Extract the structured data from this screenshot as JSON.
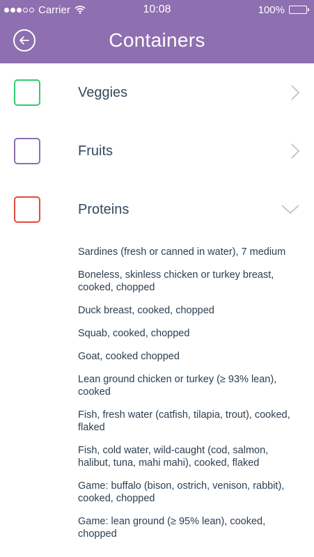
{
  "status_bar": {
    "carrier": "Carrier",
    "time": "10:08",
    "battery": "100%"
  },
  "header": {
    "title": "Containers"
  },
  "categories": [
    {
      "label": "Veggies",
      "color": "#2ecc71",
      "state": "collapsed"
    },
    {
      "label": "Fruits",
      "color": "#8e6fb0",
      "state": "collapsed"
    },
    {
      "label": "Proteins",
      "color": "#e24a3b",
      "state": "expanded"
    }
  ],
  "protein_items": [
    "Sardines (fresh or canned in water), 7 medium",
    "Boneless, skinless chicken or turkey breast, cooked, chopped",
    "Duck breast, cooked, chopped",
    "Squab, cooked, chopped",
    "Goat, cooked chopped",
    "Lean ground chicken or turkey (≥ 93% lean), cooked",
    "Fish, fresh water (catfish, tilapia, trout), cooked, flaked",
    "Fish, cold water, wild-caught (cod, salmon, halibut, tuna, mahi mahi), cooked, flaked",
    "Game: buffalo (bison, ostrich, venison, rabbit), cooked, chopped",
    "Game: lean ground (≥ 95% lean), cooked, chopped"
  ],
  "icons": {
    "back": "arrow-left-circle-icon",
    "collapsed": "chevron-right-icon",
    "expanded": "chevron-down-icon"
  },
  "colors": {
    "header": "#8e6fb0",
    "text": "#34495e",
    "chevron": "#c8c8cc"
  }
}
